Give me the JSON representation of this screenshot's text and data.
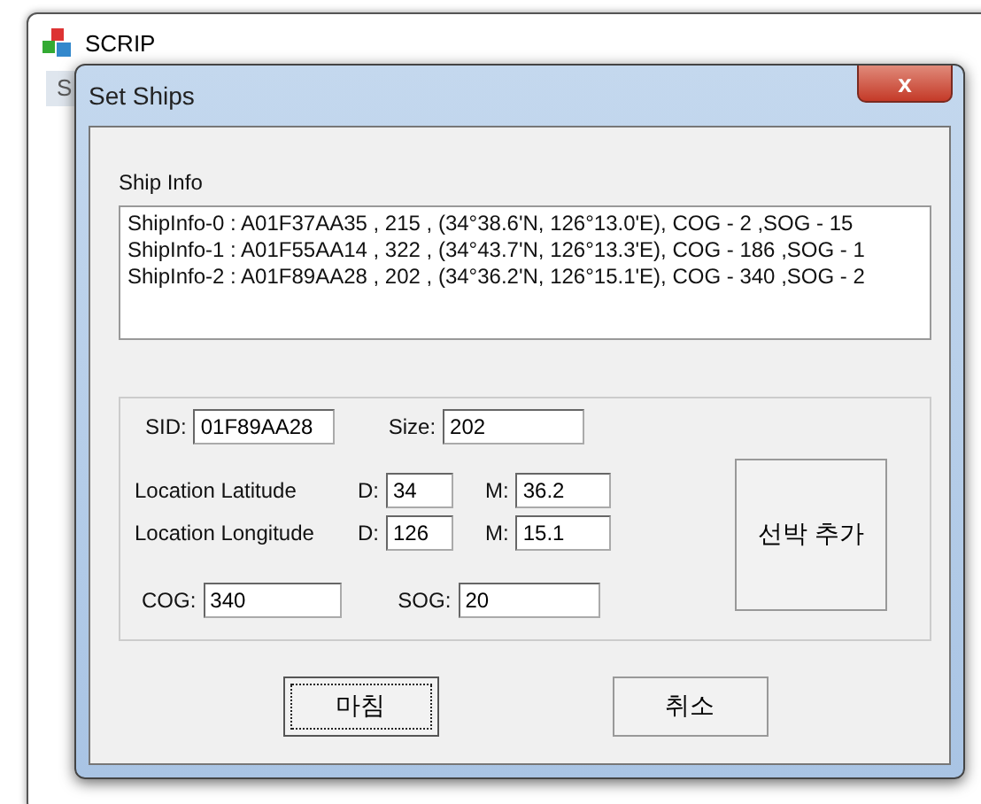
{
  "parent_window": {
    "title": "SCRIP",
    "menu_item": "S"
  },
  "dialog": {
    "title": "Set Ships",
    "close": "x"
  },
  "ship_info": {
    "label": "Ship Info",
    "items": [
      "ShipInfo-0 : A01F37AA35 , 215 , (34°38.6'N, 126°13.0'E), COG - 2 ,SOG - 15",
      "ShipInfo-1 : A01F55AA14 , 322 , (34°43.7'N, 126°13.3'E), COG - 186 ,SOG - 1",
      "ShipInfo-2 : A01F89AA28 , 202 , (34°36.2'N, 126°15.1'E), COG - 340 ,SOG - 2"
    ]
  },
  "form": {
    "sid_label": "SID:",
    "sid": "01F89AA28",
    "size_label": "Size:",
    "size": "202",
    "lat_label": "Location  Latitude",
    "lat_d_label": "D:",
    "lat_d": "34",
    "lat_m_label": "M:",
    "lat_m": "36.2",
    "lon_label": "Location  Longitude",
    "lon_d_label": "D:",
    "lon_d": "126",
    "lon_m_label": "M:",
    "lon_m": "15.1",
    "cog_label": "COG:",
    "cog": "340",
    "sog_label": "SOG:",
    "sog": "20",
    "add_button": "선박 추가"
  },
  "buttons": [
    {
      "label": "마침",
      "focused": true
    },
    {
      "label": "취소",
      "focused": false
    }
  ]
}
